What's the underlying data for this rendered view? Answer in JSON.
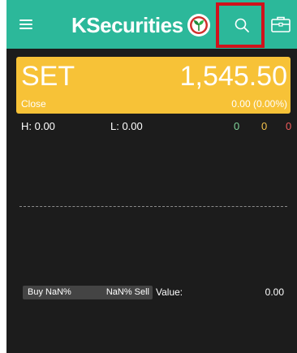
{
  "header": {
    "brand_text": "KSecurities",
    "menu_icon": "hamburger-menu-icon",
    "search_icon": "search-icon",
    "briefcase_icon": "briefcase-icon",
    "colors": {
      "header_bg": "#2cb89a",
      "highlight_border": "#d0121b"
    }
  },
  "index": {
    "name": "SET",
    "value": "1,545.50",
    "status": "Close",
    "change": "0.00 (0.00%)",
    "card_color": "#f7c237"
  },
  "stats": {
    "high": "H: 0.00",
    "low": "L: 0.00",
    "up_count": "0",
    "unchanged_count": "0",
    "down_count": "0"
  },
  "buysell": {
    "buy_label": "Buy NaN%",
    "sell_label": "NaN% Sell",
    "value_label": "Value:",
    "value_amount": "0.00"
  }
}
